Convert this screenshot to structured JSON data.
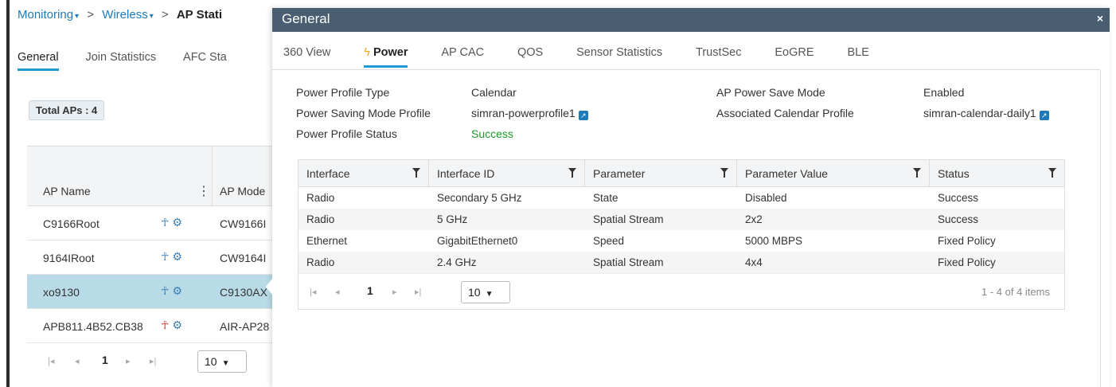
{
  "breadcrumb": {
    "items": [
      {
        "label": "Monitoring",
        "dropdown": true
      },
      {
        "label": "Wireless",
        "dropdown": true
      },
      {
        "label": "AP Stati",
        "dropdown": false
      }
    ],
    "separator": ">"
  },
  "bg_tabs": [
    {
      "label": "General",
      "active": true
    },
    {
      "label": "Join Statistics",
      "active": false
    },
    {
      "label": "AFC Sta",
      "active": false
    }
  ],
  "total_aps": "Total APs : 4",
  "ap_table": {
    "headers": {
      "ap_name": "AP Name",
      "ap_mode": "AP Mode"
    },
    "rows": [
      {
        "name": "C9166Root",
        "mode": "CW9166I",
        "selected": false,
        "tree_color": "#3b7fb6"
      },
      {
        "name": "9164IRoot",
        "mode": "CW9164I",
        "selected": false,
        "tree_color": "#3b7fb6"
      },
      {
        "name": "xo9130",
        "mode": "C9130AX",
        "selected": true,
        "tree_color": "#3b7fb6"
      },
      {
        "name": "APB811.4B52.CB38",
        "mode": "AIR-AP28",
        "selected": false,
        "tree_color": "#d63a2f"
      }
    ],
    "pager": {
      "page": "1",
      "page_size": "10"
    }
  },
  "modal": {
    "title": "General",
    "close": "×",
    "tabs": [
      {
        "label": "360 View",
        "active": false
      },
      {
        "label": "Power",
        "active": true
      },
      {
        "label": "AP CAC",
        "active": false
      },
      {
        "label": "QOS",
        "active": false
      },
      {
        "label": "Sensor Statistics",
        "active": false
      },
      {
        "label": "TrustSec",
        "active": false
      },
      {
        "label": "EoGRE",
        "active": false
      },
      {
        "label": "BLE",
        "active": false
      }
    ],
    "info": {
      "power_profile_type_label": "Power Profile Type",
      "power_profile_type_value": "Calendar",
      "power_saving_mode_profile_label": "Power Saving Mode Profile",
      "power_saving_mode_profile_value": "simran-powerprofile1",
      "power_profile_status_label": "Power Profile Status",
      "power_profile_status_value": "Success",
      "ap_power_save_mode_label": "AP Power Save Mode",
      "ap_power_save_mode_value": "Enabled",
      "associated_calendar_profile_label": "Associated Calendar Profile",
      "associated_calendar_profile_value": "simran-calendar-daily1"
    },
    "table": {
      "headers": [
        "Interface",
        "Interface ID",
        "Parameter",
        "Parameter Value",
        "Status"
      ],
      "rows": [
        [
          "Radio",
          "Secondary 5 GHz",
          "State",
          "Disabled",
          "Success"
        ],
        [
          "Radio",
          "5 GHz",
          "Spatial Stream",
          "2x2",
          "Success"
        ],
        [
          "Ethernet",
          "GigabitEthernet0",
          "Speed",
          "5000 MBPS",
          "Fixed Policy"
        ],
        [
          "Radio",
          "2.4 GHz",
          "Spatial Stream",
          "4x4",
          "Fixed Policy"
        ]
      ],
      "pager": {
        "page": "1",
        "page_size": "10",
        "summary": "1 - 4 of 4 items"
      }
    }
  },
  "colors": {
    "accent": "#1f9bd4",
    "link": "#1f7ab8",
    "success": "#1a9e2a",
    "modal_header": "#495e70",
    "selected_row": "#b9dbe8"
  }
}
